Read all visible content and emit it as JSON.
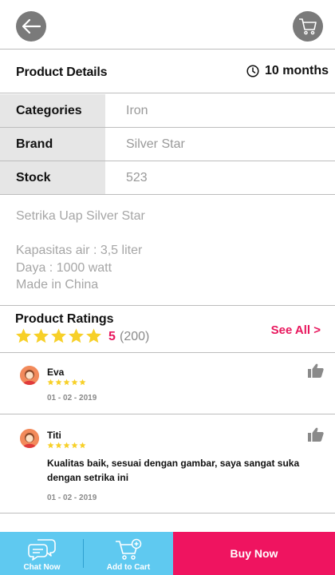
{
  "header": {
    "back_icon": "arrow-left-icon",
    "cart_icon": "shopping-cart-icon"
  },
  "details": {
    "title": "Product Details",
    "duration": "10 months",
    "duration_icon": "clock-icon"
  },
  "specs": [
    {
      "label": "Categories",
      "value": "Iron"
    },
    {
      "label": "Brand",
      "value": "Silver Star"
    },
    {
      "label": "Stock",
      "value": "523"
    }
  ],
  "description": {
    "name": "Setrika Uap Silver Star",
    "lines": [
      "Kapasitas air : 3,5 liter",
      "Daya : 1000 watt",
      "Made in China"
    ]
  },
  "ratings": {
    "title": "Product Ratings",
    "stars": 5,
    "score": "5",
    "count": "(200)",
    "see_all": "See All >"
  },
  "reviews": [
    {
      "name": "Eva",
      "stars": 5,
      "text": "",
      "date": "01 - 02 - 2019"
    },
    {
      "name": "Titi",
      "stars": 5,
      "text": "Kualitas baik, sesuai dengan gambar, saya sangat suka dengan setrika ini",
      "date": "01 - 02 - 2019"
    }
  ],
  "bottom": {
    "chat_label": "Chat Now",
    "add_cart_label": "Add to Cart",
    "buy_label": "Buy Now"
  },
  "colors": {
    "accent": "#ef1460",
    "secondary": "#5fc9f0",
    "star": "#f7d028",
    "icon_bg": "#7a7a7a"
  }
}
